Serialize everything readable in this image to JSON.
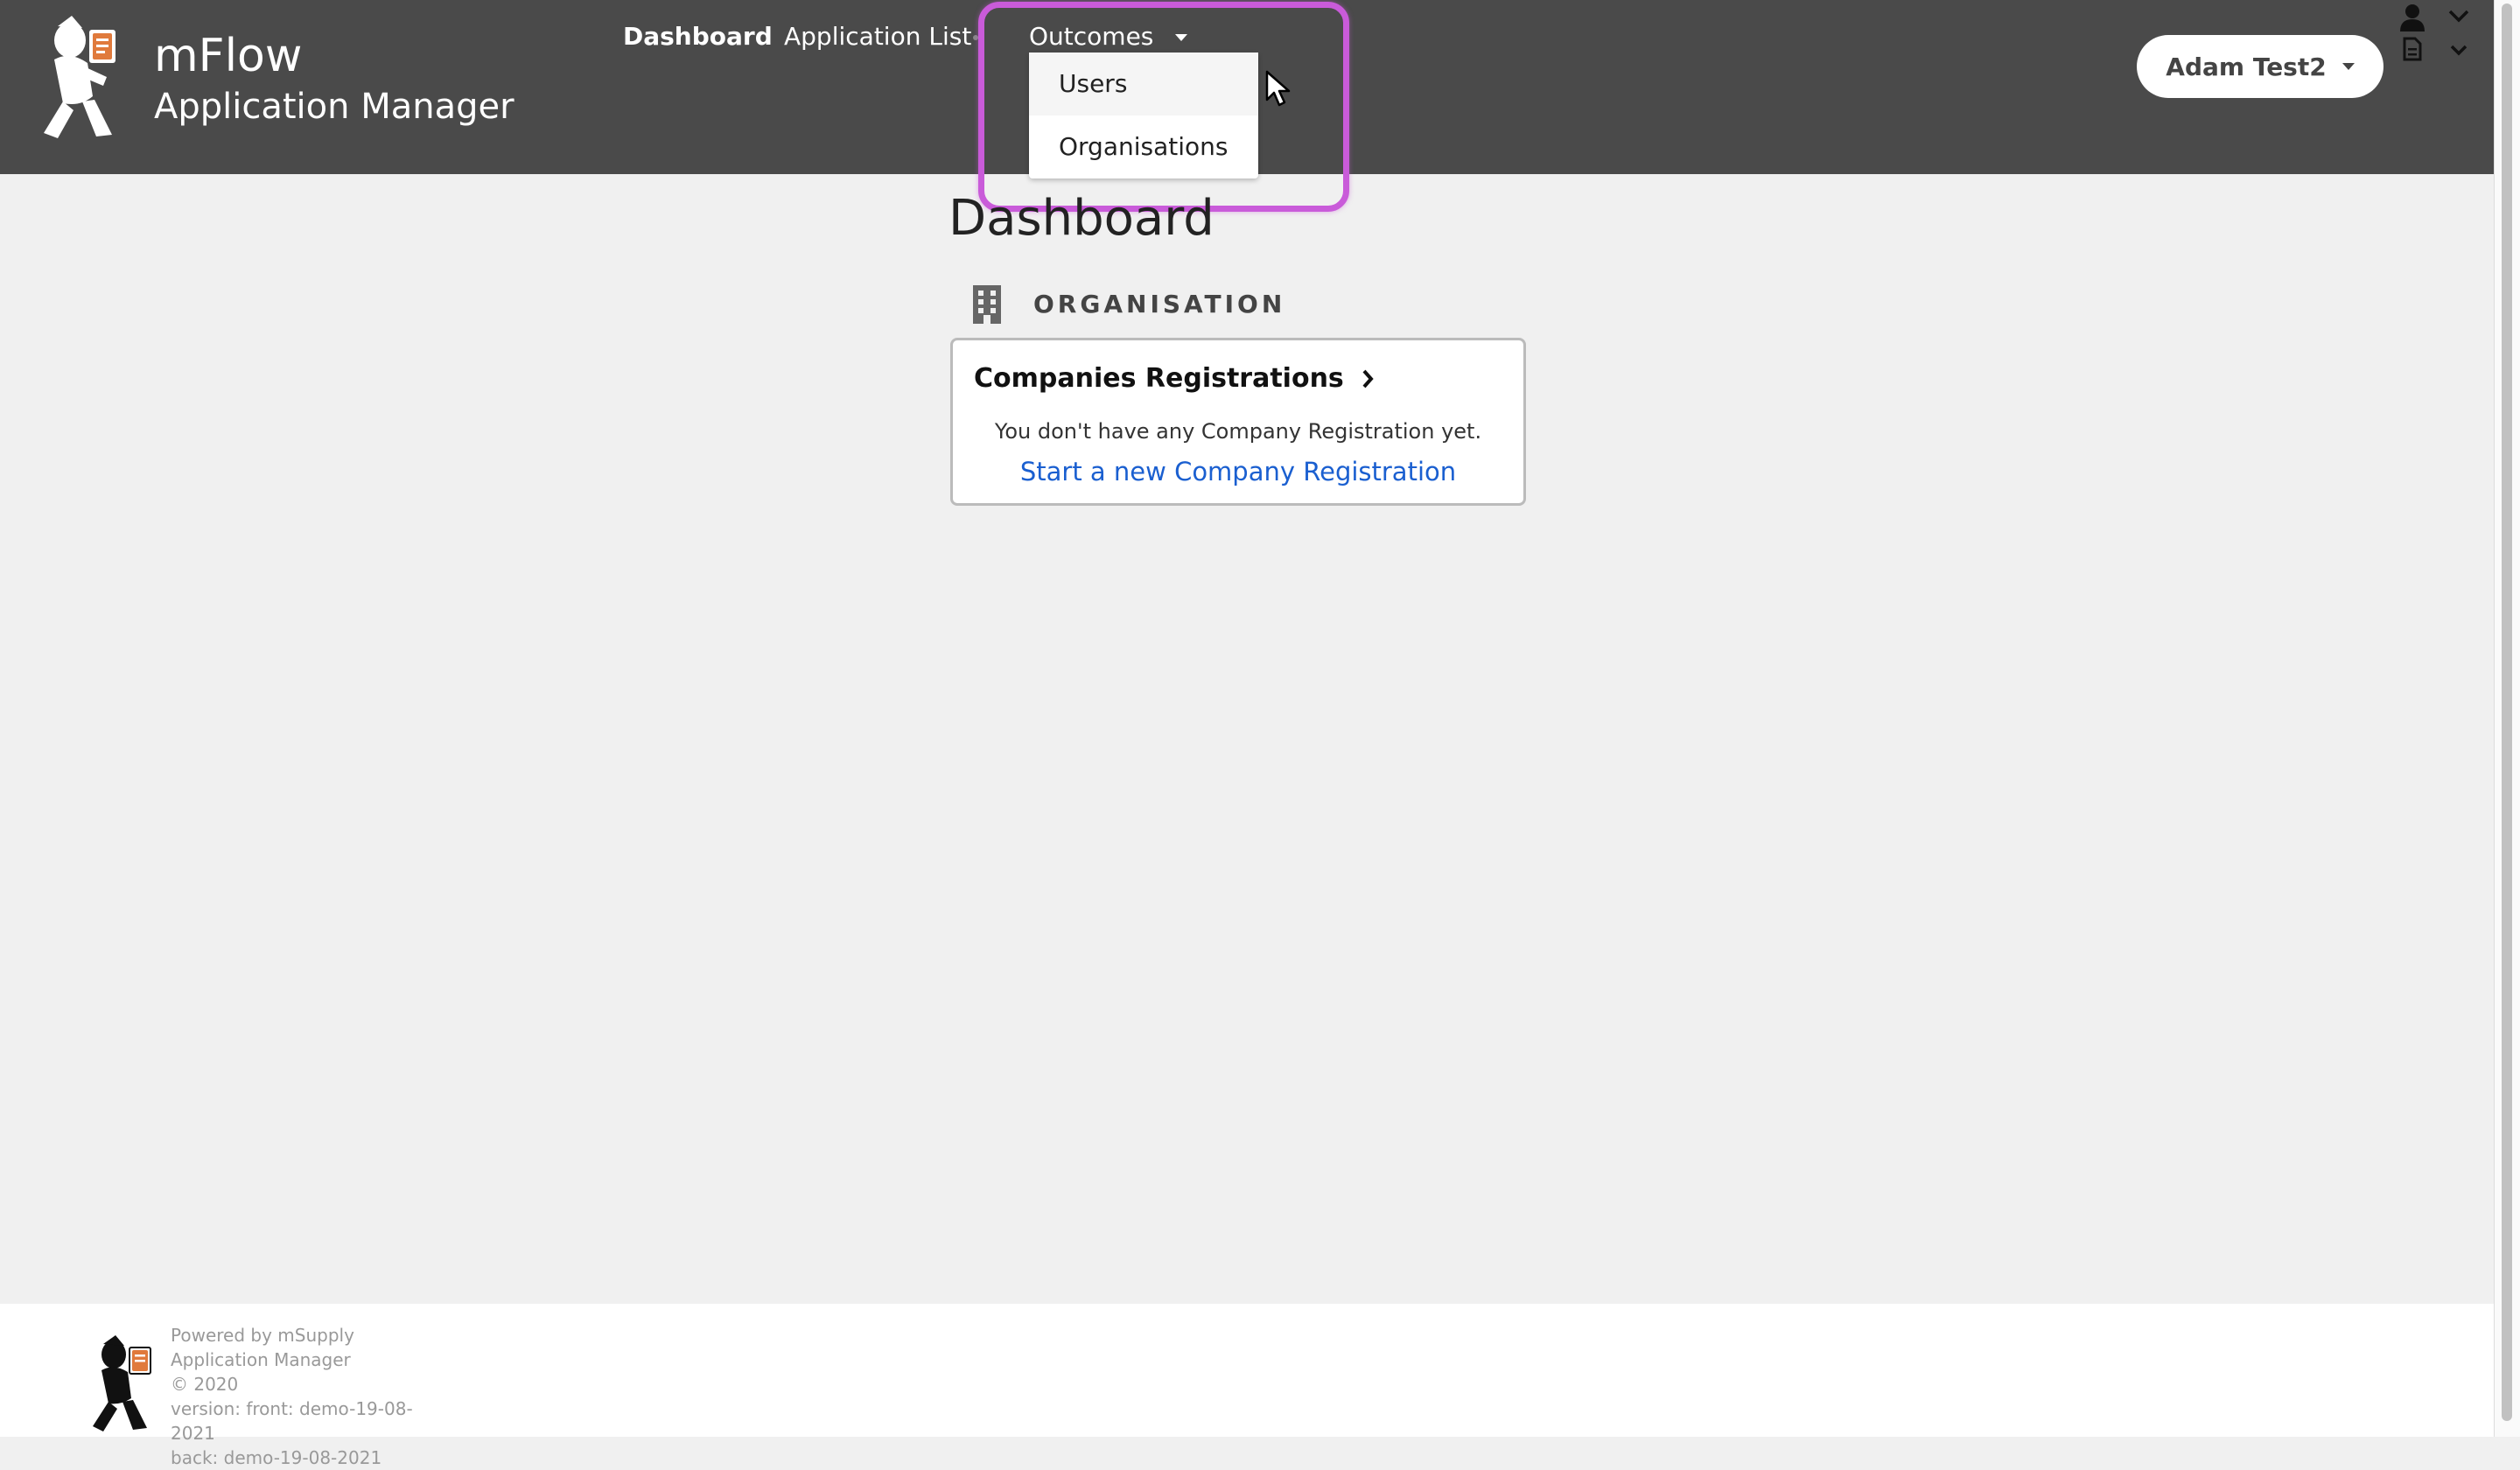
{
  "brand": {
    "name": "mFlow",
    "subtitle": "Application Manager"
  },
  "nav": {
    "items": [
      {
        "label": "Dashboard"
      },
      {
        "label": "Application List"
      },
      {
        "label": "Outcomes"
      }
    ],
    "outcomes_menu": [
      "Users",
      "Organisations"
    ]
  },
  "user": {
    "name": "Adam Test2"
  },
  "page": {
    "title": "Dashboard",
    "section": "ORGANISATION"
  },
  "card": {
    "title": "Companies Registrations",
    "empty_text": "You don't have any Company Registration yet.",
    "link": "Start a new Company Registration"
  },
  "footer": {
    "lines": [
      "Powered by mSupply Application Manager",
      "© 2020",
      "version: front: demo-19-08-2021",
      "back: demo-19-08-2021"
    ]
  },
  "colors": {
    "header": "#4a4a4a",
    "highlight": "#c95bd9",
    "link": "#1a5fd0"
  },
  "icons": {
    "logo": "runner-with-document-logo",
    "section": "building-icon",
    "user_menu": "person-icon",
    "doc_menu": "document-icon"
  }
}
